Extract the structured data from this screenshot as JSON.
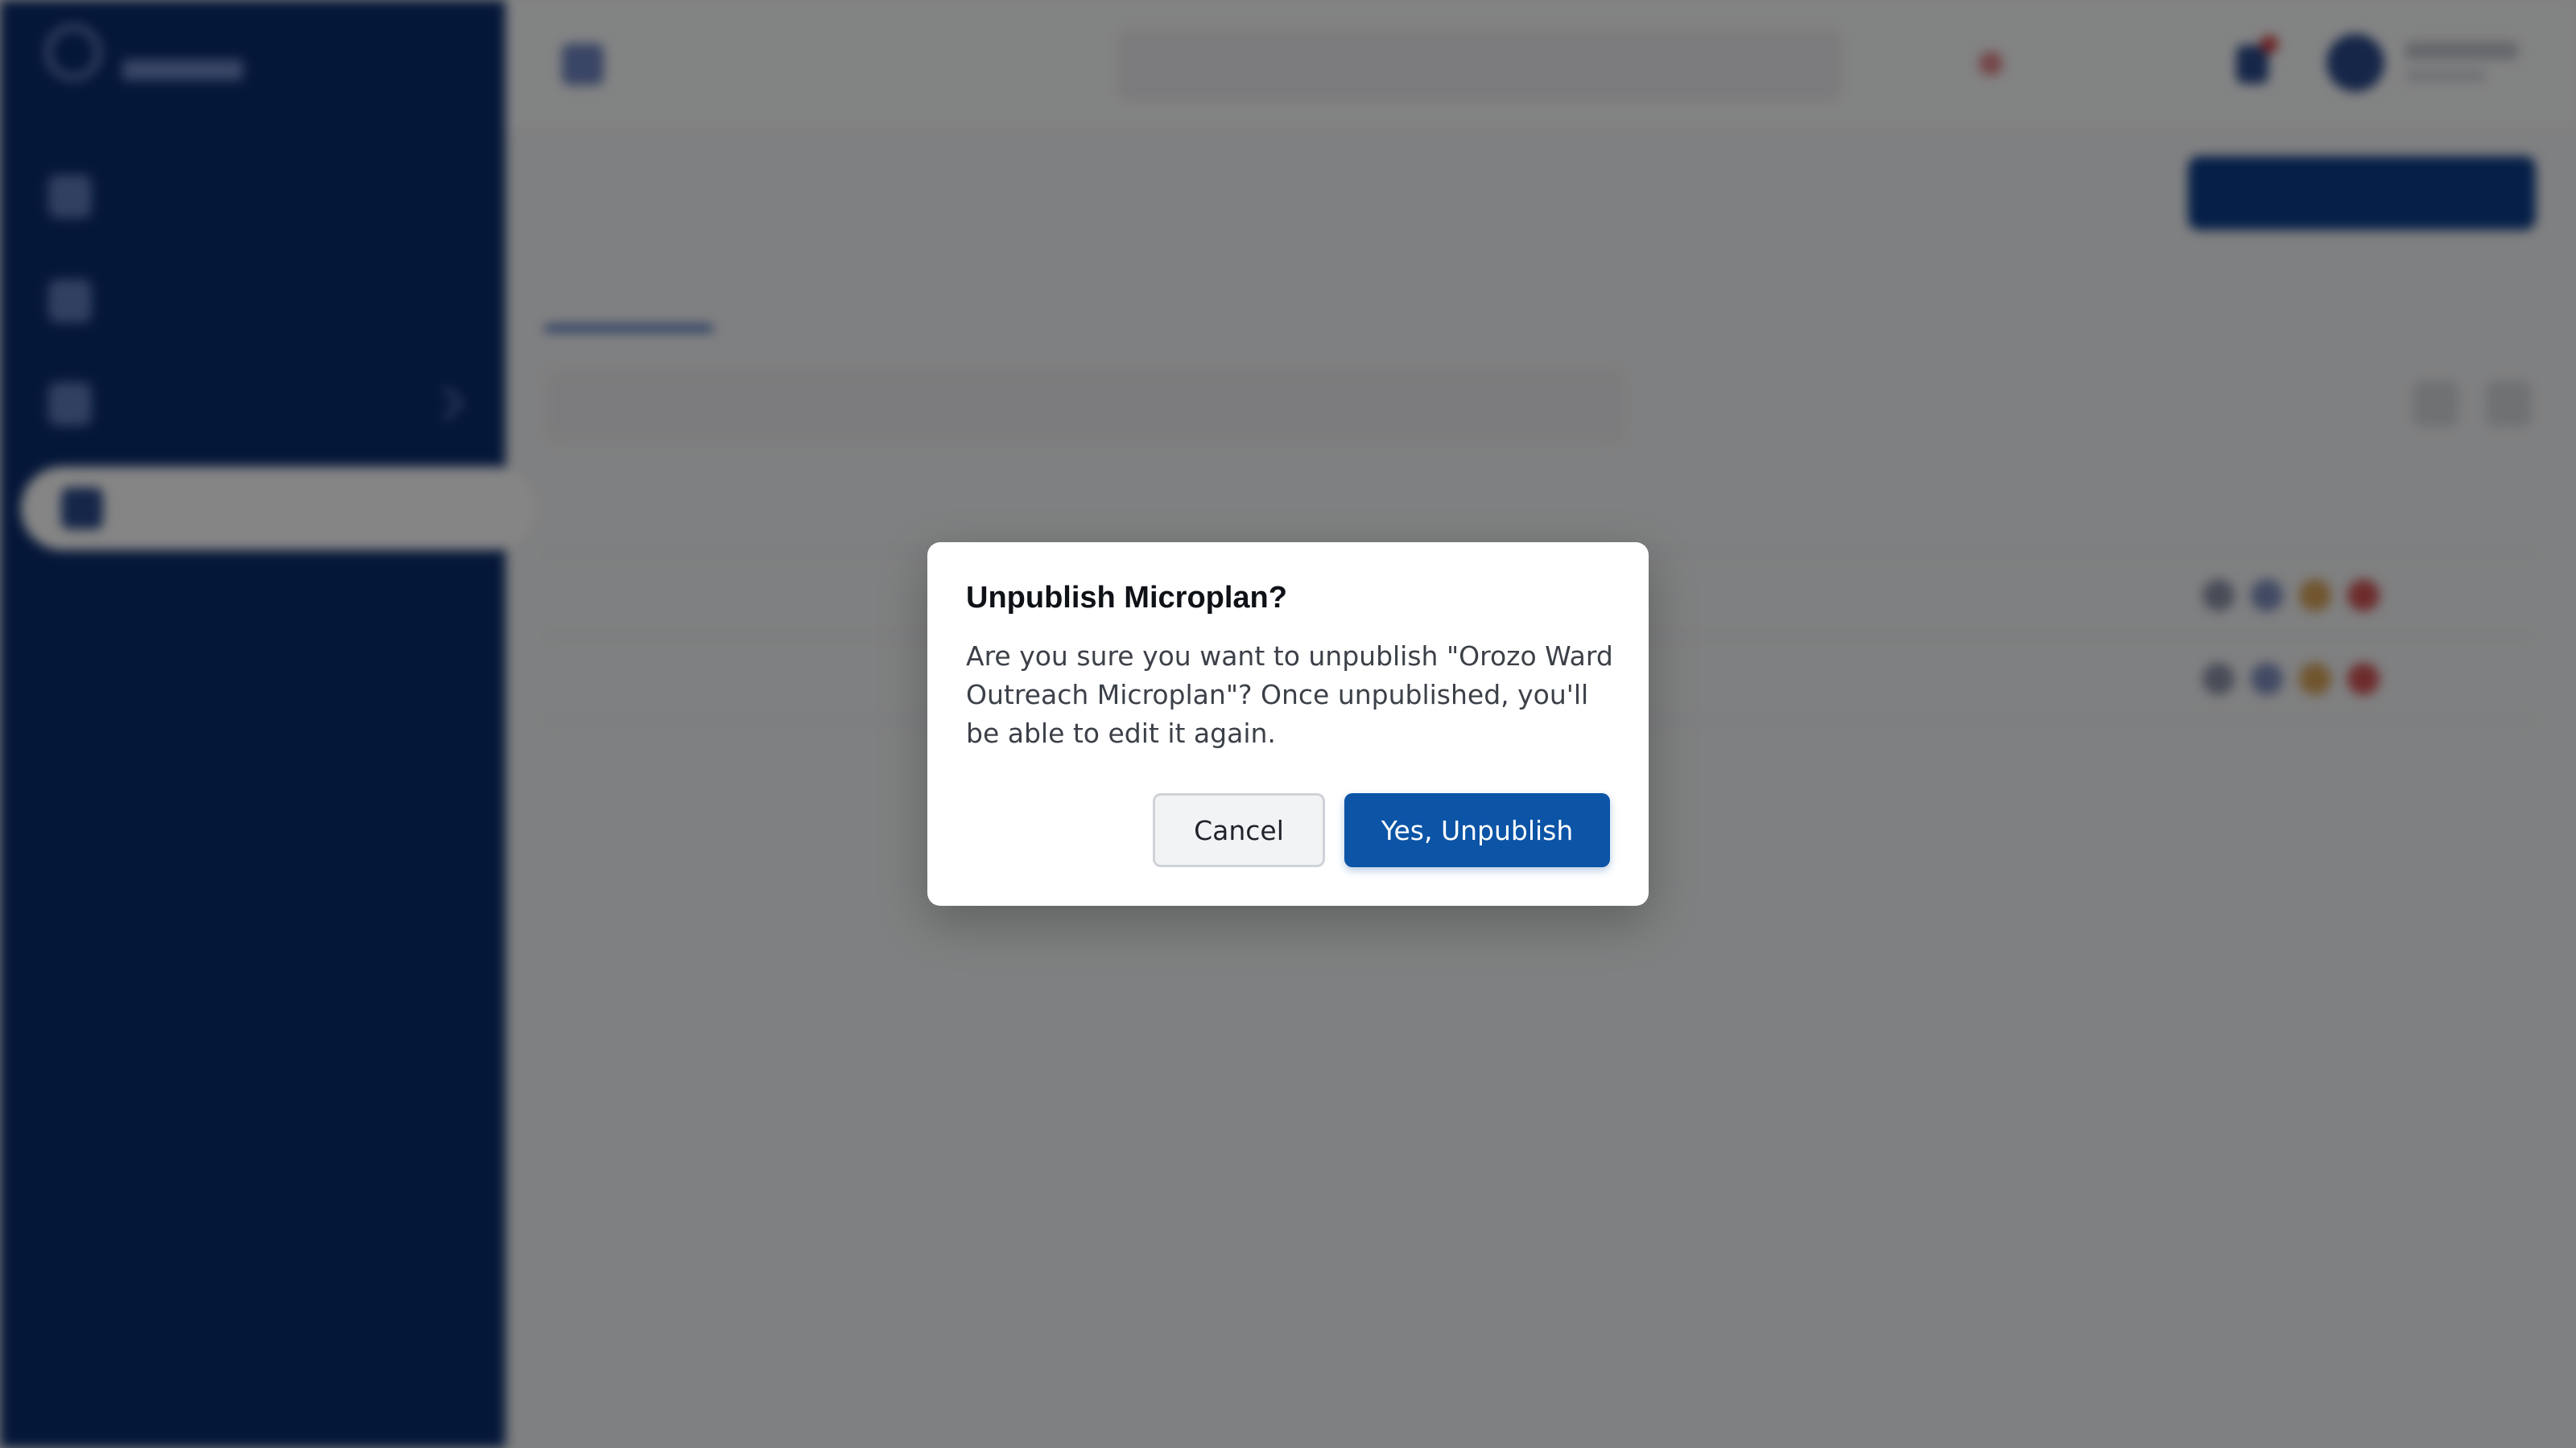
{
  "modal": {
    "title": "Unpublish Microplan?",
    "body": "Are you sure you want to unpublish \"Orozo Ward Outreach Microplan\"? Once unpublished, you'll be able to edit it again.",
    "cancel_label": "Cancel",
    "confirm_label": "Yes, Unpublish"
  },
  "colors": {
    "sidebar": "#0b2d6e",
    "primary": "#0b54a6",
    "overlay": "rgba(0,0,0,0.48)"
  },
  "icons": [
    "menu-icon",
    "bell-icon",
    "avatar-icon",
    "sidebar-nav-icon"
  ]
}
